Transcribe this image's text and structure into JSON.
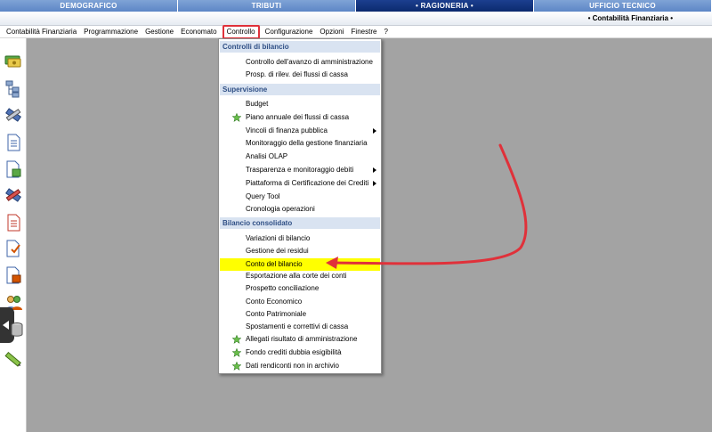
{
  "module_tabs": [
    {
      "label": "DEMOGRAFICO"
    },
    {
      "label": "TRIBUTI"
    },
    {
      "label": "• RAGIONERIA •"
    },
    {
      "label": "UFFICIO TECNICO"
    }
  ],
  "context_title": "• Contabilità Finanziaria •",
  "menubar": [
    {
      "label": "Contabilità Finanziaria"
    },
    {
      "label": "Programmazione"
    },
    {
      "label": "Gestione"
    },
    {
      "label": "Economato"
    },
    {
      "label": "Controllo"
    },
    {
      "label": "Configurazione"
    },
    {
      "label": "Opzioni"
    },
    {
      "label": "Finestre"
    },
    {
      "label": "?"
    }
  ],
  "dropdown": {
    "sections": [
      {
        "label": "Controlli di bilancio"
      },
      {
        "label": "Supervisione"
      },
      {
        "label": "Bilancio consolidato"
      }
    ],
    "items": [
      {
        "label": "Controllo dell'avanzo di amministrazione"
      },
      {
        "label": "Prosp. di rilev. dei flussi di cassa"
      },
      {
        "label": "Budget"
      },
      {
        "label": "Piano annuale dei flussi di cassa"
      },
      {
        "label": "Vincoli di finanza pubblica"
      },
      {
        "label": "Monitoraggio della gestione finanziaria"
      },
      {
        "label": "Analisi OLAP"
      },
      {
        "label": "Trasparenza e monitoraggio debiti"
      },
      {
        "label": "Piattaforma di Certificazione dei Crediti"
      },
      {
        "label": "Query Tool"
      },
      {
        "label": "Cronologia operazioni"
      },
      {
        "label": "Variazioni di bilancio"
      },
      {
        "label": "Gestione dei residui"
      },
      {
        "label": "Conto del bilancio"
      },
      {
        "label": "Esportazione alla corte dei conti"
      },
      {
        "label": "Prospetto conciliazione"
      },
      {
        "label": "Conto Economico"
      },
      {
        "label": "Conto Patrimoniale"
      },
      {
        "label": "Spostamenti e correttivi di cassa"
      },
      {
        "label": "Allegati risultato di amministrazione"
      },
      {
        "label": "Fondo crediti dubbia esigibilità"
      },
      {
        "label": "Dati rendiconti non in archivio"
      }
    ]
  },
  "colors": {
    "highlight": "#ffff00",
    "annotation": "#e0313a",
    "active_tab": "#0b2a6e"
  }
}
